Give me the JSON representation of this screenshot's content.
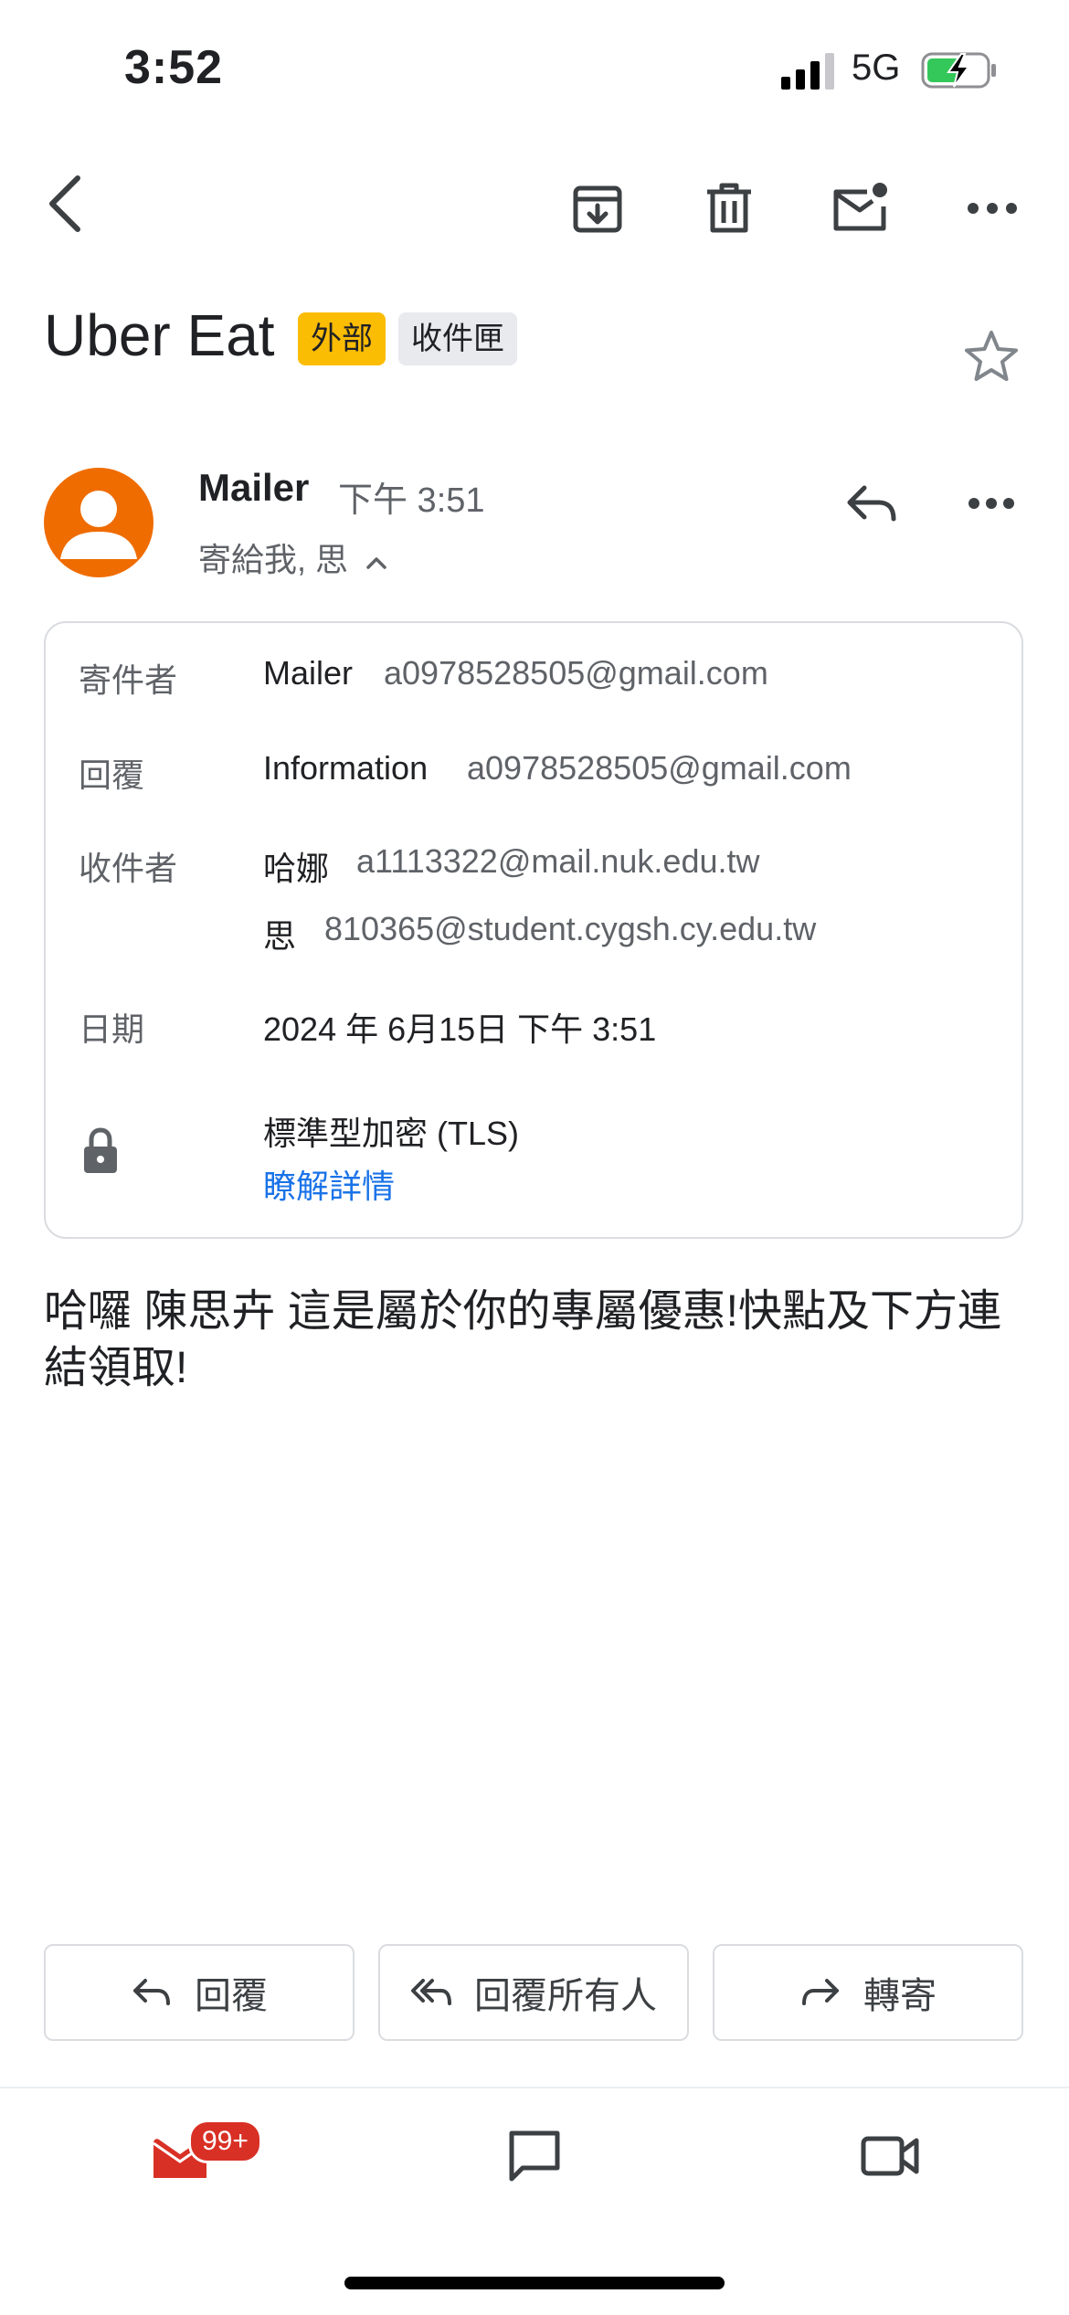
{
  "status_bar": {
    "time": "3:52",
    "network": "5G"
  },
  "email": {
    "subject": "Uber Eat",
    "labels": [
      "外部",
      "收件匣"
    ],
    "sender_name": "Mailer",
    "sent_time": "下午 3:51",
    "to_summary": "寄給我, 思",
    "details": {
      "from_label": "寄件者",
      "from_name": "Mailer",
      "from_email": "a0978528505@gmail.com",
      "reply_label": "回覆",
      "reply_name": "Information",
      "reply_email": "a0978528505@gmail.com",
      "to_label": "收件者",
      "to": [
        {
          "name": "哈娜",
          "email": "a1113322@mail.nuk.edu.tw"
        },
        {
          "name": "思",
          "email": "810365@student.cygsh.cy.edu.tw"
        }
      ],
      "date_label": "日期",
      "date_value": "2024 年 6月15日 下午 3:51",
      "encryption": "標準型加密 (TLS)",
      "learn_more": "瞭解詳情"
    },
    "body": "哈囉 陳思卉 這是屬於你的專屬優惠!快點及下方連結領取!"
  },
  "actions": {
    "reply": "回覆",
    "reply_all": "回覆所有人",
    "forward": "轉寄"
  },
  "bottom_nav": {
    "mail_badge": "99+"
  },
  "colors": {
    "avatar": "#ef6c00",
    "external_badge": "#fbbc04",
    "link": "#1a73e8",
    "mail_icon": "#d93025"
  }
}
